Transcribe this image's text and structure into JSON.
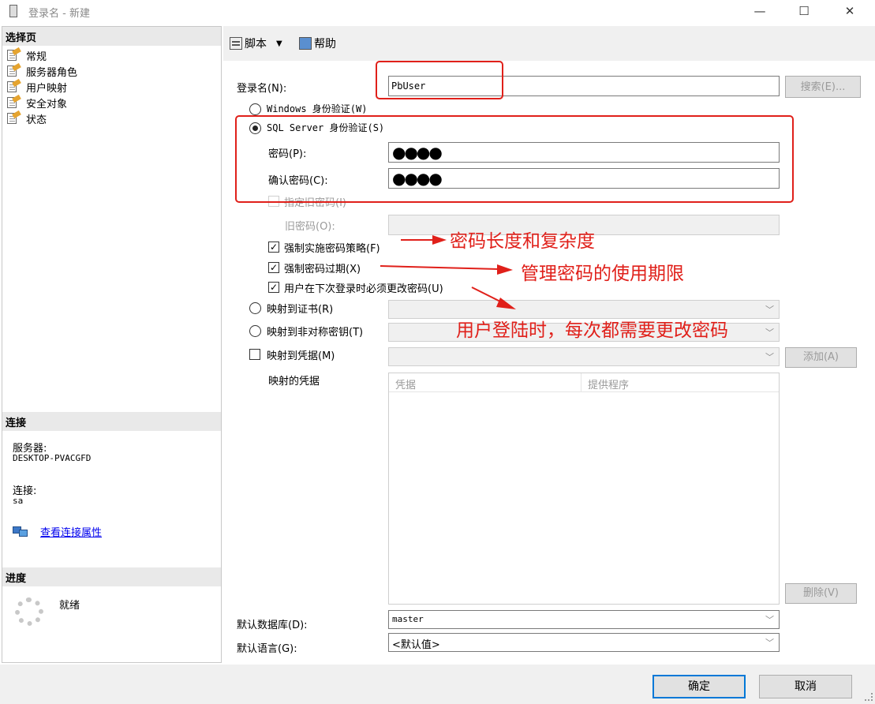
{
  "window": {
    "title": "登录名 - 新建",
    "minimize_glyph": "—",
    "maximize_glyph": "☐",
    "close_glyph": "✕"
  },
  "left_pane": {
    "select_page_header": "选择页",
    "nav_items": [
      "常规",
      "服务器角色",
      "用户映射",
      "安全对象",
      "状态"
    ],
    "connection_header": "连接",
    "server_label": "服务器:",
    "server_value": "DESKTOP-PVACGFD",
    "connection_label": "连接:",
    "connection_value": "sa",
    "view_connection_properties": "查看连接属性",
    "progress_header": "进度",
    "progress_status": "就绪"
  },
  "toolbar": {
    "script_label": "脚本",
    "help_label": "帮助"
  },
  "form": {
    "login_name_label": "登录名(N):",
    "login_name_value": "PbUser",
    "search_button": "搜索(E)...",
    "windows_auth_label": "Windows 身份验证(W)",
    "sql_auth_label": "SQL Server 身份验证(S)",
    "auth_mode": "sql",
    "password_label": "密码(P):",
    "password_dots": "●●●●",
    "confirm_password_label": "确认密码(C):",
    "confirm_password_dots": "●●●●",
    "specify_old_password_label": "指定旧密码(I)",
    "old_password_label": "旧密码(O):",
    "enforce_policy_label": "强制实施密码策略(F)",
    "enforce_policy_checked": true,
    "enforce_expiration_label": "强制密码过期(X)",
    "enforce_expiration_checked": true,
    "must_change_label": "用户在下次登录时必须更改密码(U)",
    "must_change_checked": true,
    "map_certificate_label": "映射到证书(R)",
    "map_asym_key_label": "映射到非对称密钥(T)",
    "map_credential_label": "映射到凭据(M)",
    "add_button": "添加(A)",
    "mapped_credentials_label": "映射的凭据",
    "credentials_columns": [
      "凭据",
      "提供程序"
    ],
    "remove_button": "删除(V)",
    "default_database_label": "默认数据库(D):",
    "default_database_value": "master",
    "default_language_label": "默认语言(G):",
    "default_language_value": "<默认值>"
  },
  "annotations": {
    "password_complexity": "密码长度和复杂度",
    "password_expiration": "管理密码的使用期限",
    "change_every_login": "用户登陆时，每次都需要更改密码"
  },
  "buttons": {
    "ok": "确定",
    "cancel": "取消"
  },
  "colors": {
    "annotation_red": "#e0201a",
    "link_blue": "#0000ee",
    "default_button_border": "#0078d7"
  }
}
